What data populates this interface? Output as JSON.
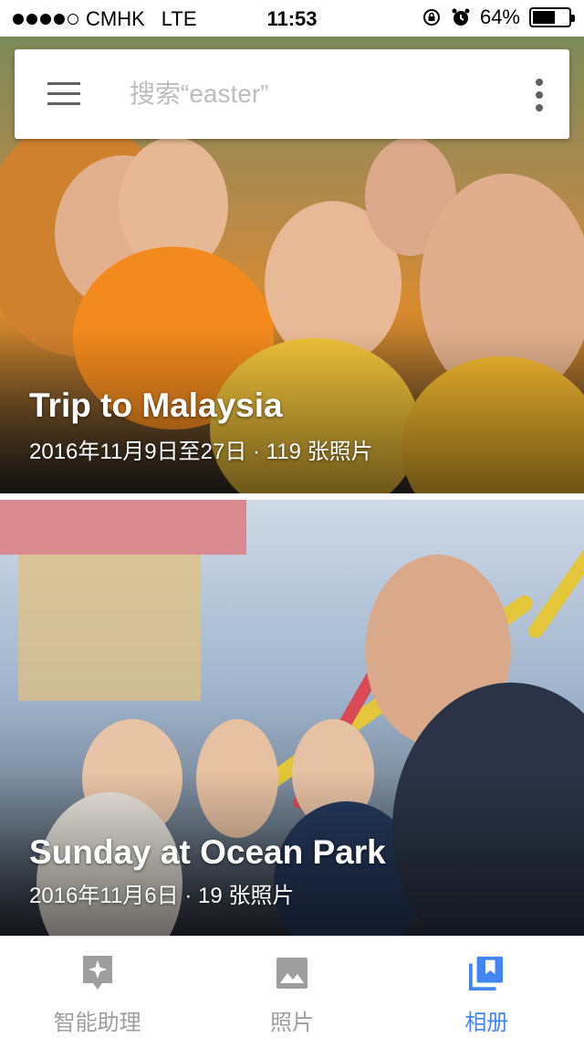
{
  "status_bar": {
    "carrier": "CMHK",
    "network": "LTE",
    "time": "11:53",
    "battery": "64%",
    "battery_level": 0.64
  },
  "search": {
    "placeholder": "搜索“easter”",
    "menu_icon": "hamburger-menu-icon",
    "more_icon": "more-vert-icon"
  },
  "albums": [
    {
      "title": "Trip to Malaysia",
      "meta": "2016年11月9日至27日 · 119 张照片"
    },
    {
      "title": "Sunday at Ocean Park",
      "meta": "2016年11月6日 · 19 张照片"
    }
  ],
  "bottom_nav": {
    "items": [
      {
        "label": "智能助理",
        "icon": "assistant-sparkle-icon",
        "active": false
      },
      {
        "label": "照片",
        "icon": "photo-icon",
        "active": false
      },
      {
        "label": "相册",
        "icon": "albums-icon",
        "active": true
      }
    ]
  },
  "colors": {
    "accent": "#4285f4",
    "inactive": "#9e9e9e"
  }
}
